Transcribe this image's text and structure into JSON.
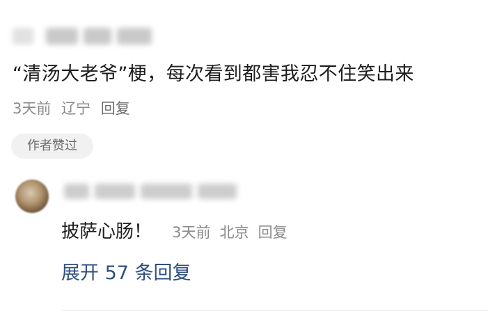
{
  "comment": {
    "text": "“清汤大老爷”梗，每次看到都害我忍不住笑出来",
    "time": "3天前",
    "location": "辽宁",
    "reply_label": "回复",
    "badge": "作者赞过"
  },
  "reply": {
    "text": "披萨心肠！",
    "time": "3天前",
    "location": "北京",
    "reply_label": "回复",
    "expand_label": "展开 57 条回复"
  }
}
